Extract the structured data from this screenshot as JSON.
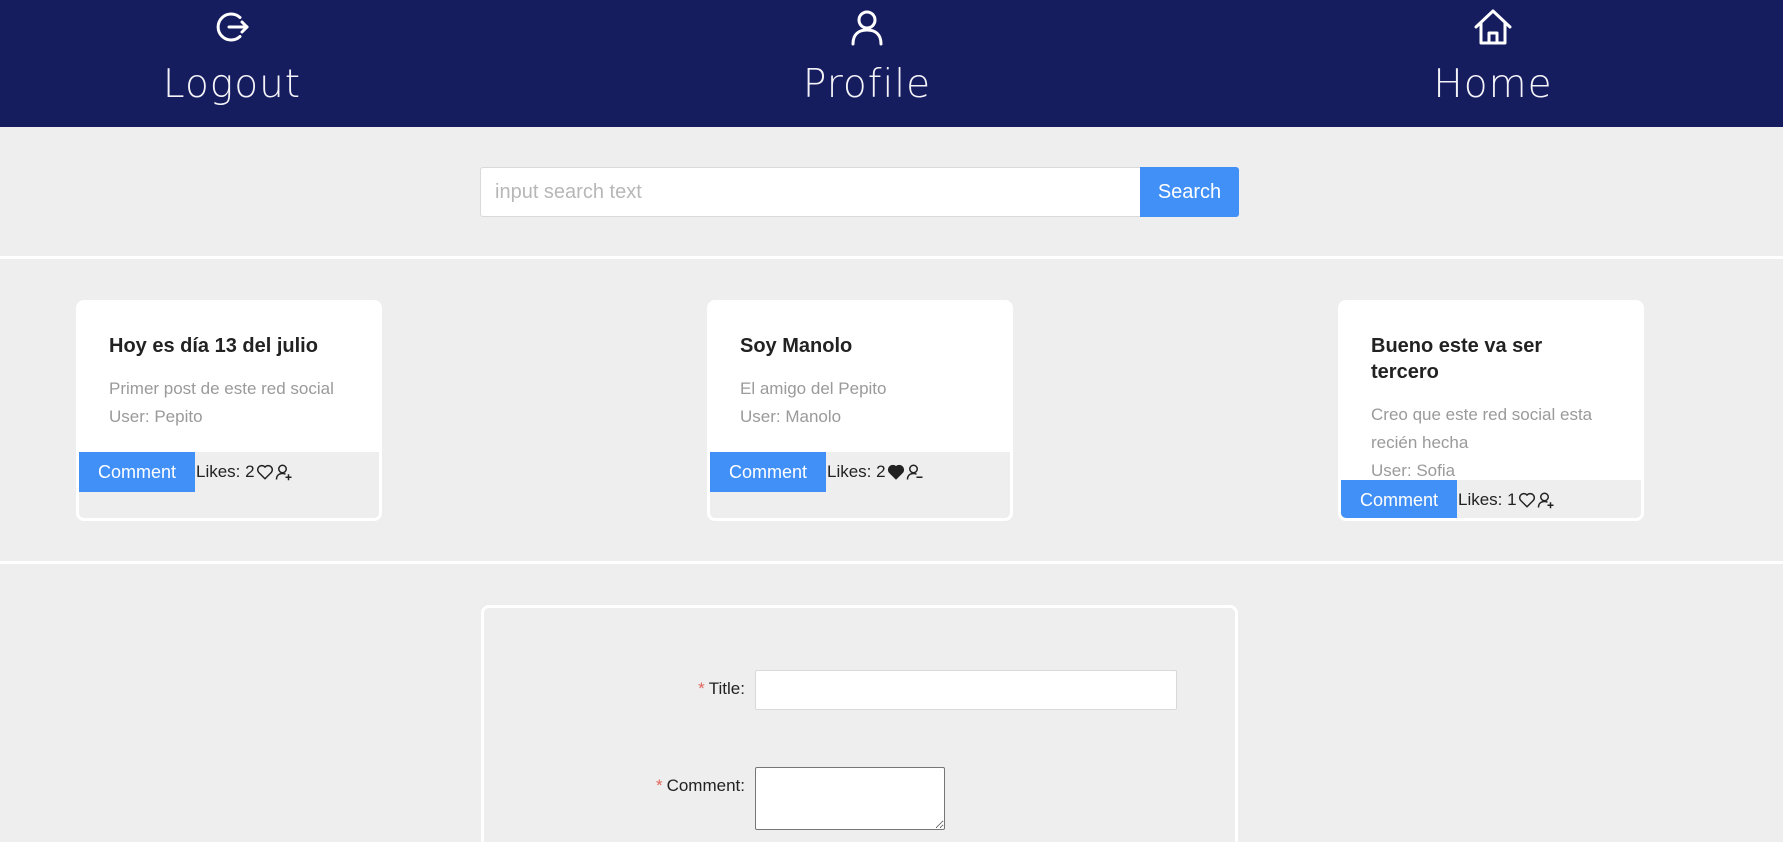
{
  "nav": {
    "logout": {
      "label": "Logout",
      "icon": "logout-icon"
    },
    "profile": {
      "label": "Profile",
      "icon": "user-icon"
    },
    "home": {
      "label": "Home",
      "icon": "home-icon"
    }
  },
  "search": {
    "placeholder": "input search text",
    "value": "",
    "button_label": "Search"
  },
  "posts": [
    {
      "title": "Hoy es día 13 del julio",
      "body": "Primer post de este red social",
      "user": "User: Pepito",
      "comment_label": "Comment",
      "likes": "Likes: 2",
      "liked": false
    },
    {
      "title": "Soy Manolo",
      "body": "El amigo del Pepito",
      "user": "User: Manolo",
      "comment_label": "Comment",
      "likes": "Likes: 2",
      "liked": true
    },
    {
      "title": "Bueno este va ser tercero",
      "body": "Creo que este red social esta recién hecha",
      "user": "User: Sofia",
      "comment_label": "Comment",
      "likes": "Likes: 1",
      "liked": false
    }
  ],
  "form": {
    "title_label": "Title",
    "comment_label": "Comment",
    "required_mark": "*",
    "colon": ":",
    "title_value": "",
    "comment_value": ""
  },
  "colors": {
    "nav_bg": "#161d5f",
    "accent": "#4190f7",
    "page_bg": "#eeeeee",
    "required": "#e0665c"
  }
}
